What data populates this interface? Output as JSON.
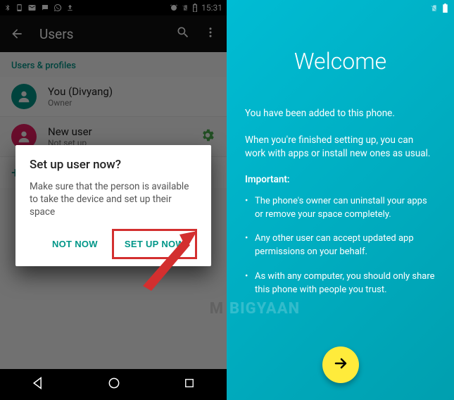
{
  "left": {
    "status": {
      "time": "15:31"
    },
    "appbar": {
      "title": "Users"
    },
    "section_header": "Users & profiles",
    "users": [
      {
        "name": "You (Divyang)",
        "sub": "Owner"
      },
      {
        "name": "New user",
        "sub": "Not set up"
      }
    ],
    "dialog": {
      "title": "Set up user now?",
      "body": "Make sure that the person is available to take the device and set up their space",
      "not_now": "NOT NOW",
      "set_up": "SET UP NOW"
    }
  },
  "right": {
    "title": "Welcome",
    "p1": "You have been added to this phone.",
    "p2": "When you're finished setting up, you can work with apps or install new ones as usual.",
    "important_label": "Important:",
    "bullets": [
      "The phone's owner can uninstall your apps or remove your space completely.",
      "Any other user can accept updated app permissions on your behalf.",
      "As with any computer, you should only share this phone with people you trust."
    ]
  },
  "watermark": {
    "left_part": "M",
    "right_part": "BIGYAAN"
  }
}
